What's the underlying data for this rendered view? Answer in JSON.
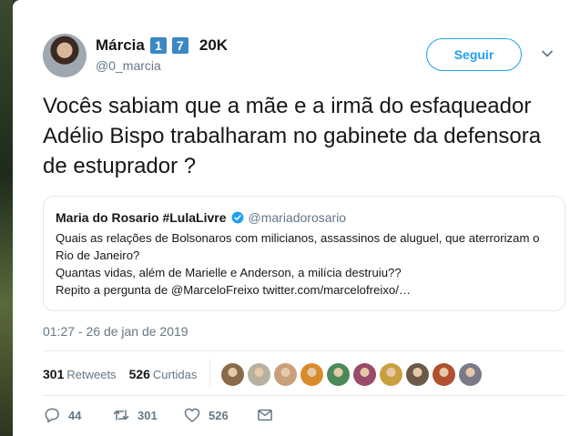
{
  "author": {
    "display_name": "Márcia",
    "badges": [
      "1",
      "7"
    ],
    "followers_short": "20K",
    "handle": "@0_marcia"
  },
  "follow_label": "Seguir",
  "tweet_text": "Vocês sabiam que a mãe e a irmã do esfaqueador Adélio Bispo trabalharam no gabinete da defensora de estuprador ?",
  "quote": {
    "name": "Maria do Rosario #LulaLivre",
    "handle": "@mariadorosario",
    "lines": [
      "Quais as relações de Bolsonaros com milicianos, assassinos de aluguel, que aterrorizam o Rio de Janeiro?",
      "Quantas vidas, além de Marielle e Anderson, a milícia destruiu??",
      "Repito a pergunta de @MarceloFreixo twitter.com/marcelofreixo/…"
    ]
  },
  "timestamp": "01:27 - 26 de jan de 2019",
  "stats": {
    "retweets_count": "301",
    "retweets_label": "Retweets",
    "likes_count": "526",
    "likes_label": "Curtidas"
  },
  "liker_colors": [
    "#8a6a4a",
    "#b8b0a0",
    "#c9a07a",
    "#d98a2a",
    "#4a8a5a",
    "#9a4a6a",
    "#c8a040",
    "#6a5a4a",
    "#b05030",
    "#7a7a8a"
  ],
  "actions": {
    "reply_count": "44",
    "retweet_count": "301",
    "like_count": "526"
  },
  "colors": {
    "accent": "#1da1f2",
    "badge_blue": "#3b88c3",
    "text": "#14171a",
    "muted": "#657786"
  }
}
